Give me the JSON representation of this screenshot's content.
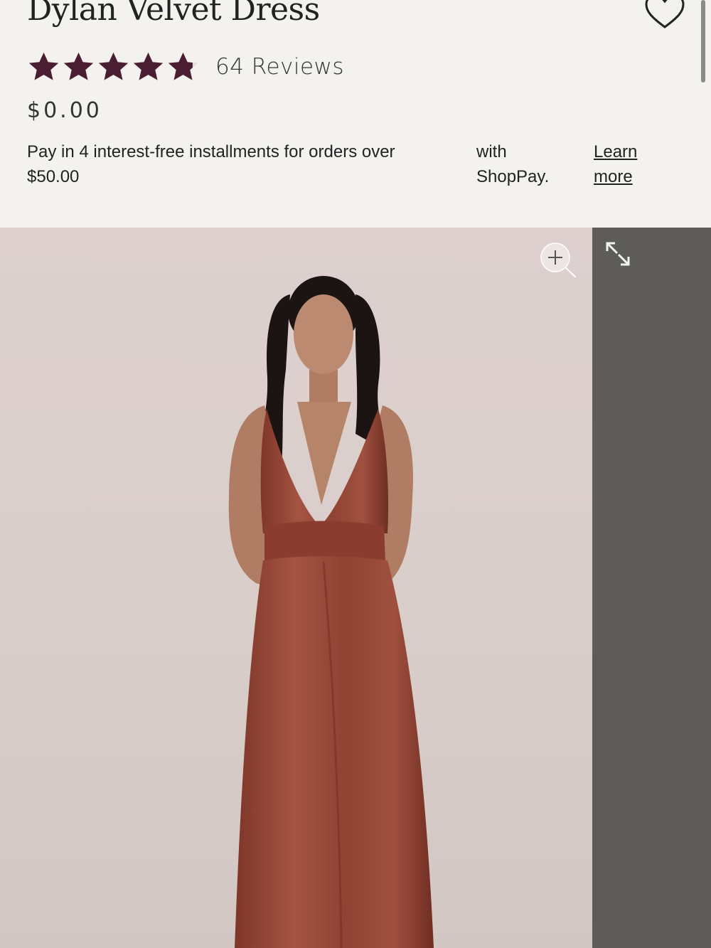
{
  "product": {
    "title": "Dylan Velvet Dress",
    "rating_stars": 4.8,
    "reviews_label": "64 Reviews",
    "price": "$0.00"
  },
  "installments": {
    "text_line1": "Pay in 4 interest-free installments for orders over",
    "text_line2": "$50.00",
    "with_line1": "with",
    "with_line2": "ShopPay.",
    "learn_line1": "Learn",
    "learn_line2": "more"
  },
  "icons": {
    "favorite": "heart-icon",
    "zoom": "zoom-in-icon",
    "expand": "expand-icon"
  },
  "colors": {
    "star": "#4a1d33",
    "background": "#f4f2ef",
    "dress": "#9b4a3a"
  }
}
